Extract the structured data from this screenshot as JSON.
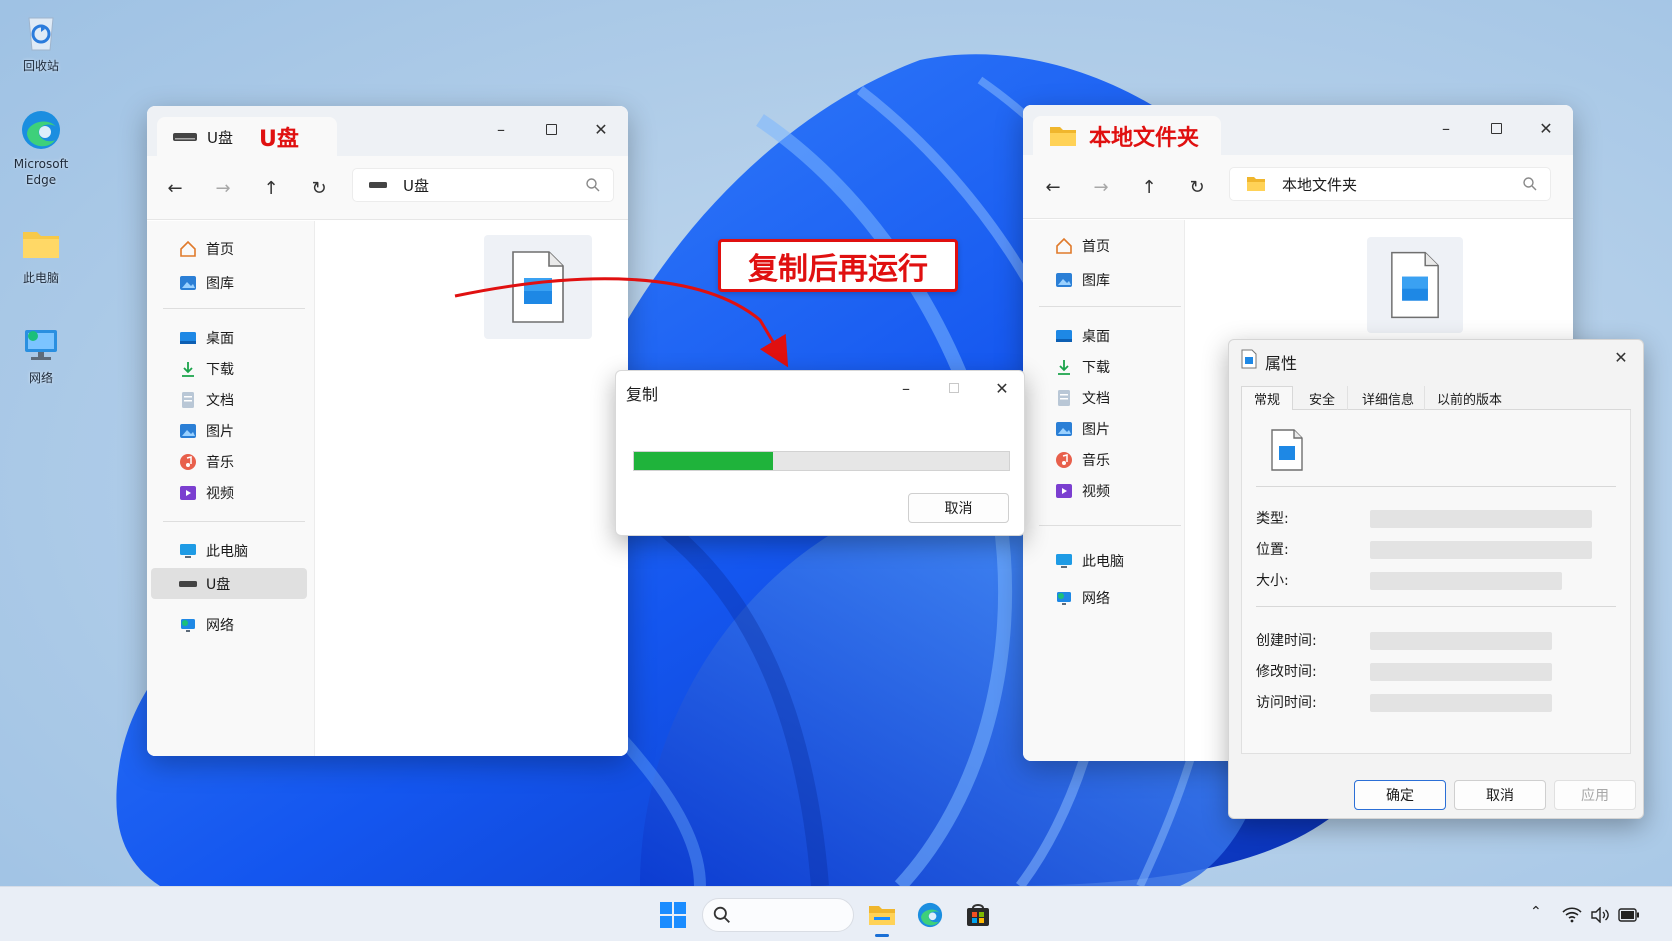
{
  "desktop": {
    "icons": [
      {
        "label": "回收站"
      },
      {
        "label": "Microsoft Edge"
      },
      {
        "label": "此电脑"
      },
      {
        "label": "网络"
      }
    ]
  },
  "left_window": {
    "tab_title": "U盘",
    "annotation_tag": "U盘",
    "address": "U盘",
    "sidebar": {
      "home": "首页",
      "gallery": "图库",
      "desktop": "桌面",
      "downloads": "下载",
      "documents": "文档",
      "pictures": "图片",
      "music": "音乐",
      "videos": "视频",
      "this_pc": "此电脑",
      "usb": "U盘",
      "network": "网络"
    }
  },
  "right_window": {
    "tab_title": "本地文件夹",
    "address": "本地文件夹",
    "sidebar": {
      "home": "首页",
      "gallery": "图库",
      "desktop": "桌面",
      "downloads": "下载",
      "documents": "文档",
      "pictures": "图片",
      "music": "音乐",
      "videos": "视频",
      "this_pc": "此电脑",
      "network": "网络"
    }
  },
  "copy_dialog": {
    "title": "复制",
    "progress_fraction": 0.37,
    "cancel": "取消"
  },
  "annotation": {
    "text": "复制后再运行"
  },
  "properties": {
    "title": "属性",
    "tabs": [
      "常规",
      "安全",
      "详细信息",
      "以前的版本"
    ],
    "labels": {
      "type": "类型:",
      "location": "位置:",
      "size": "大小:",
      "created": "创建时间:",
      "modified": "修改时间:",
      "accessed": "访问时间:"
    },
    "buttons": {
      "ok": "确定",
      "cancel": "取消",
      "apply": "应用"
    }
  },
  "colors": {
    "accent_red": "#e01010",
    "progress_green": "#1fb33b",
    "folder_yellow": "#f7c948"
  }
}
